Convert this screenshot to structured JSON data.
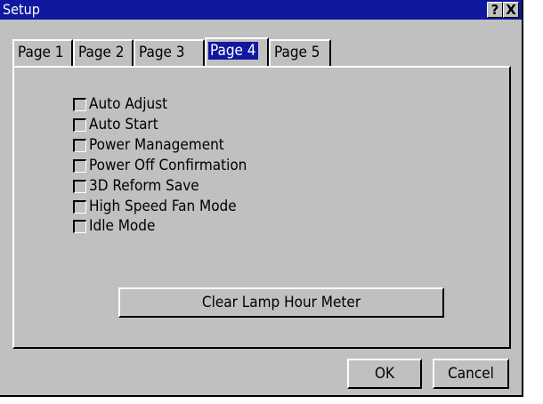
{
  "window": {
    "title": "Setup",
    "help_glyph": "?",
    "close_glyph": "X"
  },
  "tabs": [
    {
      "label": "Page 1",
      "active": false
    },
    {
      "label": "Page 2",
      "active": false
    },
    {
      "label": "Page 3",
      "active": false
    },
    {
      "label": "Page 4",
      "active": true
    },
    {
      "label": "Page 5",
      "active": false
    }
  ],
  "options": [
    {
      "label": "Auto Adjust",
      "checked": false
    },
    {
      "label": "Auto Start",
      "checked": false
    },
    {
      "label": "Power Management",
      "checked": false
    },
    {
      "label": "Power Off Confirmation",
      "checked": false
    },
    {
      "label": "3D Reform Save",
      "checked": false
    },
    {
      "label": "High Speed Fan Mode",
      "checked": false
    },
    {
      "label": "Idle Mode",
      "checked": false
    }
  ],
  "buttons": {
    "clear_lamp": "Clear Lamp Hour Meter",
    "ok": "OK",
    "cancel": "Cancel"
  },
  "colors": {
    "titlebar": "#1018a0",
    "face": "#c0c0c0",
    "active_tab_highlight": "#1018a0"
  }
}
